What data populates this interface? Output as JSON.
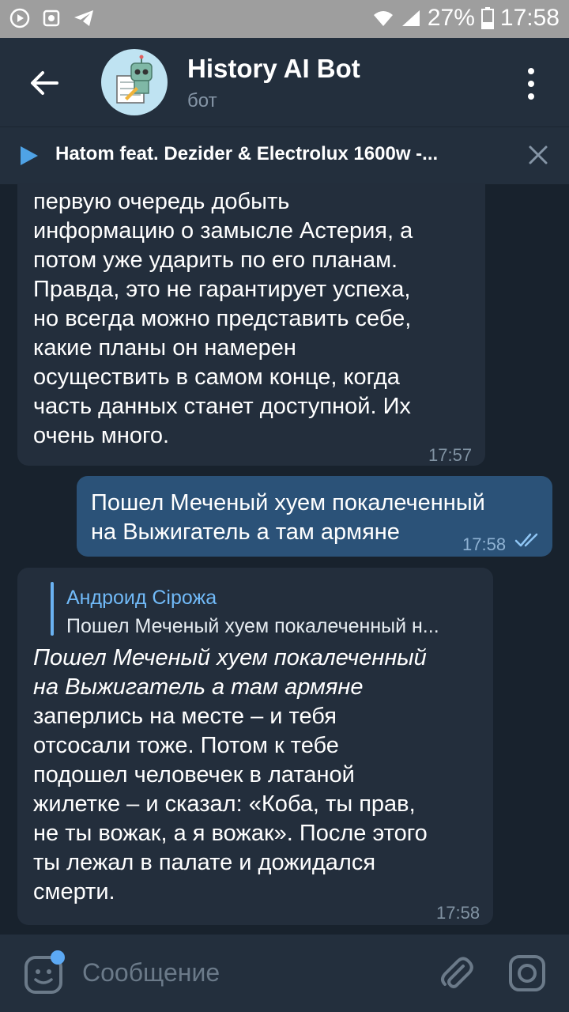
{
  "status_bar": {
    "battery": "27%",
    "time": "17:58"
  },
  "header": {
    "title": "History AI Bot",
    "subtitle": "бот"
  },
  "player": {
    "track": "Hatom feat. Dezider & Electrolux 1600w -..."
  },
  "messages": [
    {
      "direction": "in",
      "text": "первую очередь добыть\nинформацию о замысле Астерия, а\nпотом уже ударить по его планам.\nПравда, это не гарантирует успеха,\nно всегда можно представить себе,\nкакие планы он намерен\nосуществить в самом конце, когда\nчасть данных станет доступной. Их\nочень много.",
      "time": "17:57"
    },
    {
      "direction": "out",
      "text": "Пошел Меченый хуем покалеченный\nна Выжигатель а там армяне",
      "time": "17:58",
      "read": true
    },
    {
      "direction": "in",
      "reply_to_name": "Андроид Сірожа",
      "reply_to_text": "Пошел Меченый хуем покалеченный н...",
      "quote": "Пошел Меченый хуем покалеченный\nна Выжигатель а там армяне",
      "text": "заперлись на месте – и тебя\nотсосали тоже. Потом к тебе\nподошел человечек в латаной\nжилетке – и сказал: «Коба, ты прав,\nне ты вожак, а я вожак». После этого\nты лежал в палате и дожидался\nсмерти.",
      "time": "17:58"
    }
  ],
  "composer": {
    "placeholder": "Сообщение"
  },
  "colors": {
    "background": "#18222d",
    "header": "#232f3d",
    "bubble_in": "#232e3c",
    "bubble_out": "#2b5278",
    "accent": "#6ab2f2"
  },
  "icons": [
    "back-arrow-icon",
    "bot-avatar",
    "more-vert-icon",
    "play-icon",
    "close-icon",
    "emoji-icon",
    "attach-icon",
    "camera-icon",
    "double-check-icon"
  ]
}
